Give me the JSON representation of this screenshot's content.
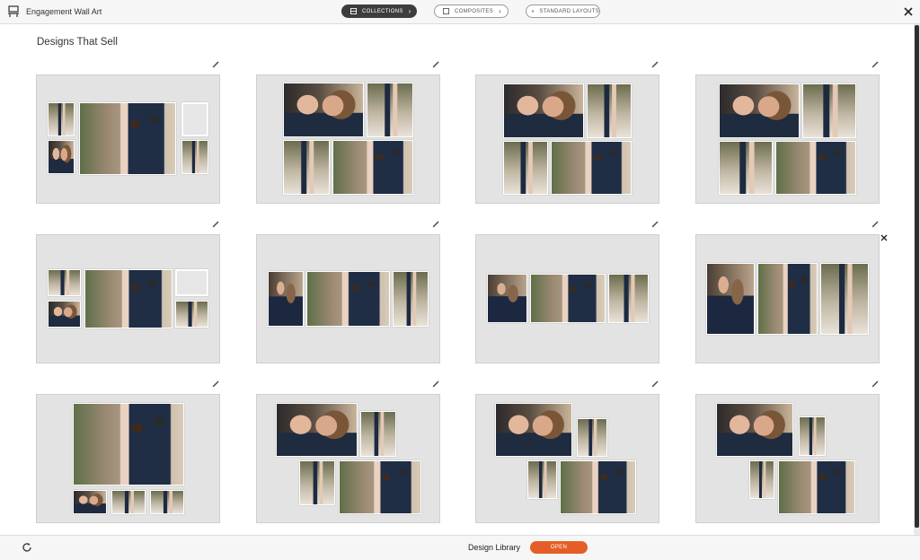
{
  "app": {
    "title": "Engagement Wall Art"
  },
  "nav": {
    "collections": "COLLECTIONS",
    "composites": "COMPOSITES",
    "standard_layouts": "STANDARD LAYOUTS"
  },
  "section": {
    "title": "Designs That Sell"
  },
  "footer": {
    "label": "Design Library",
    "open_button": "OPEN"
  },
  "icons": {
    "app": "wall-art-icon",
    "close": "close-icon",
    "edit": "pencil-icon",
    "refresh": "refresh-icon"
  },
  "colors": {
    "accent": "#e35f27",
    "active_pill": "#3d3d3d",
    "card_bg": "#e3e3e3"
  }
}
